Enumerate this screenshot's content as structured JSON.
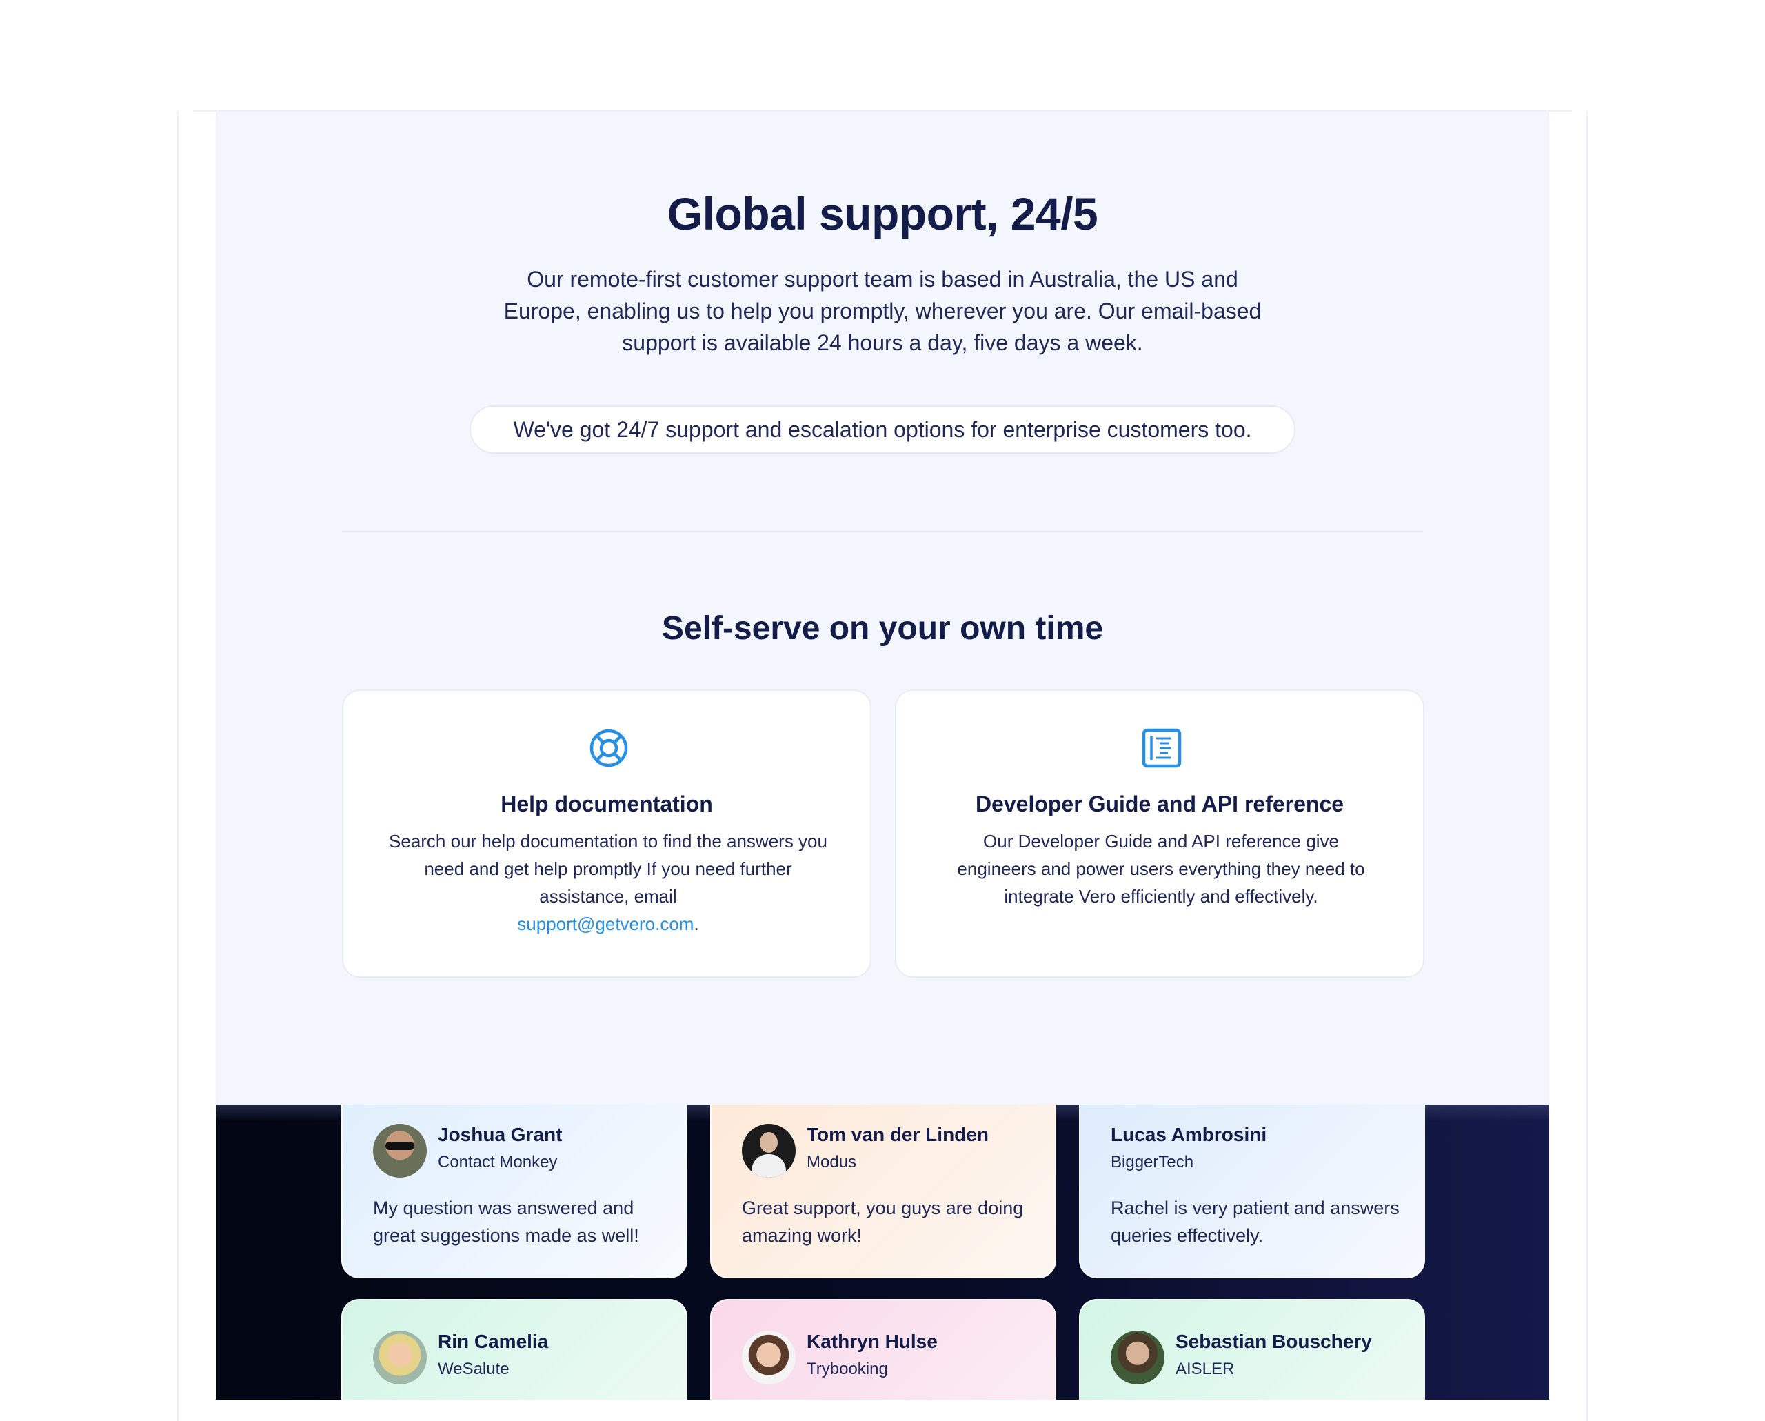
{
  "support": {
    "title": "Global support, 24/5",
    "description": "Our remote-first customer support team is based in Australia, the US and Europe, enabling us to help you promptly, wherever you are. Our email-based support is available 24 hours a day, five days a week.",
    "enterprise_note": "We've got 24/7 support and escalation options for enterprise customers too."
  },
  "self_serve": {
    "title": "Self-serve on your own time",
    "cards": [
      {
        "icon": "lifebuoy-icon",
        "title": "Help documentation",
        "text": "Search our help documentation to find the answers you need and get help promptly If you need further assistance, email",
        "link": "support@getvero.com",
        "suffix": "."
      },
      {
        "icon": "document-list-icon",
        "title": "Developer Guide and API reference",
        "text": "Our Developer Guide and API reference give engineers and power users everything they need to integrate Vero efficiently and effectively."
      }
    ]
  },
  "testimonials": [
    {
      "name": "Joshua Grant",
      "company": "Contact Monkey",
      "quote": "My question was answered and great suggestions made as well!"
    },
    {
      "name": "Tom van der Linden",
      "company": "Modus",
      "quote": "Great support, you guys are doing amazing work!"
    },
    {
      "name": "Lucas Ambrosini",
      "company": "BiggerTech",
      "quote": "Rachel is very patient and answers queries effectively."
    },
    {
      "name": "Rin Camelia",
      "company": "WeSalute",
      "quote": ""
    },
    {
      "name": "Kathryn Hulse",
      "company": "Trybooking",
      "quote": ""
    },
    {
      "name": "Sebastian Bouschery",
      "company": "AISLER",
      "quote": ""
    }
  ],
  "colors": {
    "heading": "#141c4a",
    "accent": "#2690e6",
    "panel_bg": "#f3f7fd",
    "dark_bg": "#070b24"
  }
}
